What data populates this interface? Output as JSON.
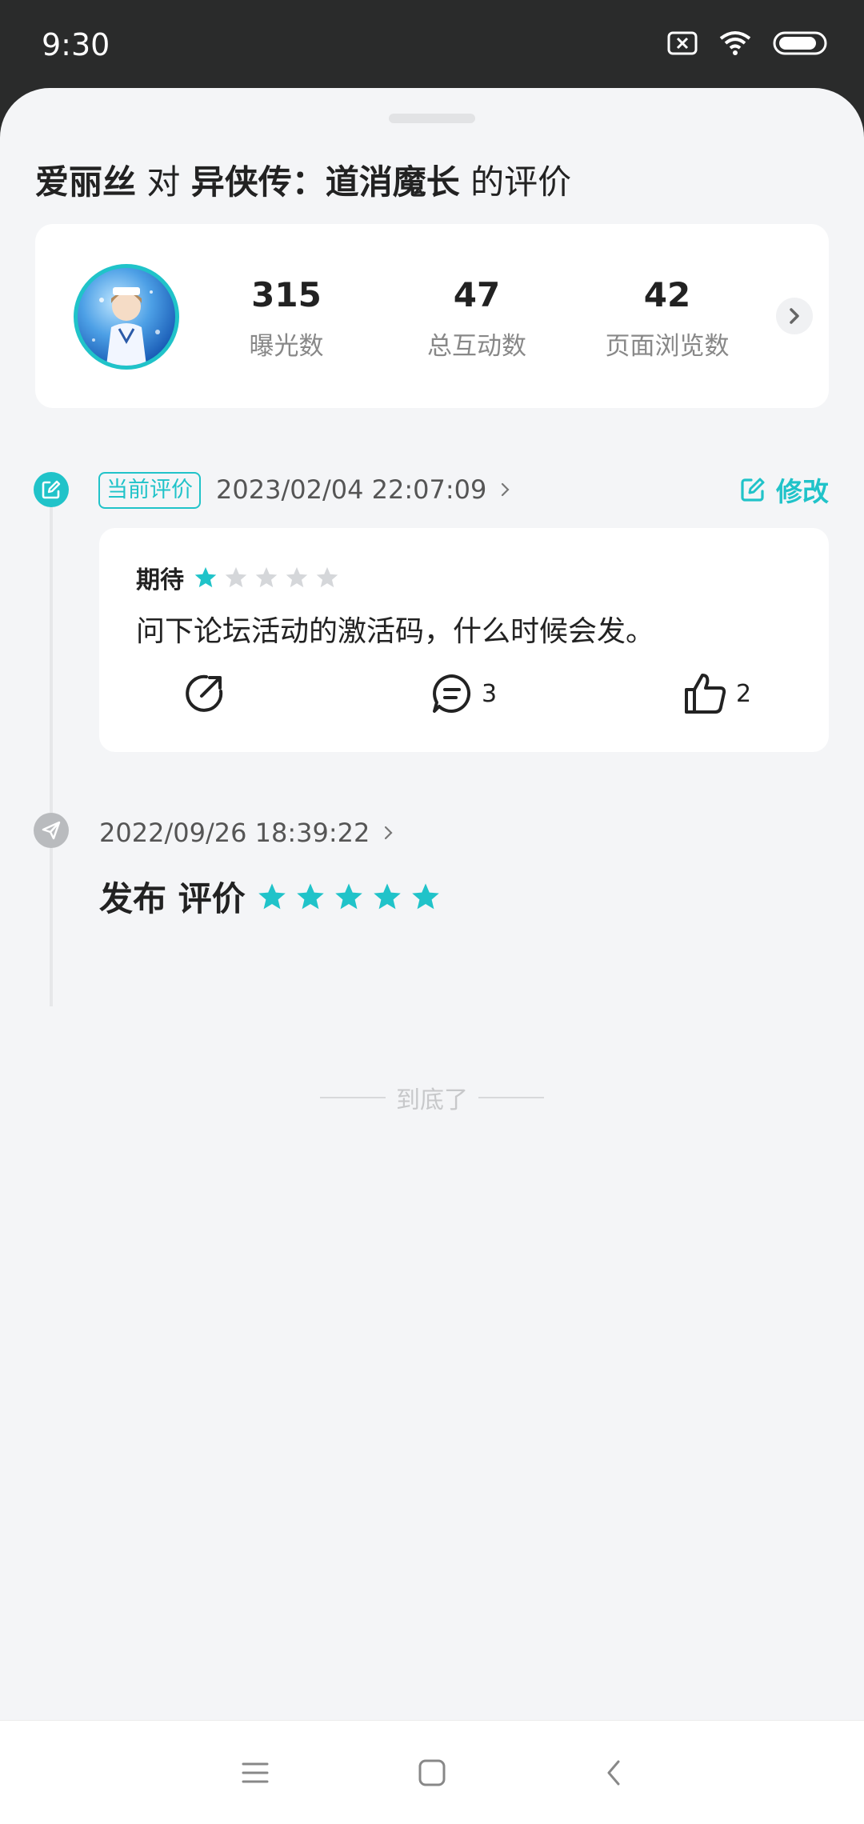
{
  "status": {
    "time": "9:30"
  },
  "title": {
    "user": "爱丽丝",
    "connector": "对",
    "game": "异侠传：道消魔长",
    "suffix": "的评价"
  },
  "stats": [
    {
      "value": "315",
      "label": "曝光数"
    },
    {
      "value": "47",
      "label": "总互动数"
    },
    {
      "value": "42",
      "label": "页面浏览数"
    }
  ],
  "review_current": {
    "badge": "当前评价",
    "date": "2023/02/04 22:07:09",
    "edit_label": "修改",
    "rating_label": "期待",
    "rating": 1,
    "rating_max": 5,
    "text": "问下论坛活动的激活码，什么时候会发。",
    "comments": "3",
    "likes": "2"
  },
  "review_previous": {
    "date": "2022/09/26 18:39:22",
    "label": "发布 评价",
    "rating": 5,
    "rating_max": 5
  },
  "end_text": "到底了",
  "colors": {
    "accent": "#20c3c9",
    "star_empty": "#d5d7da",
    "dot_gray": "#b9bbbe"
  }
}
